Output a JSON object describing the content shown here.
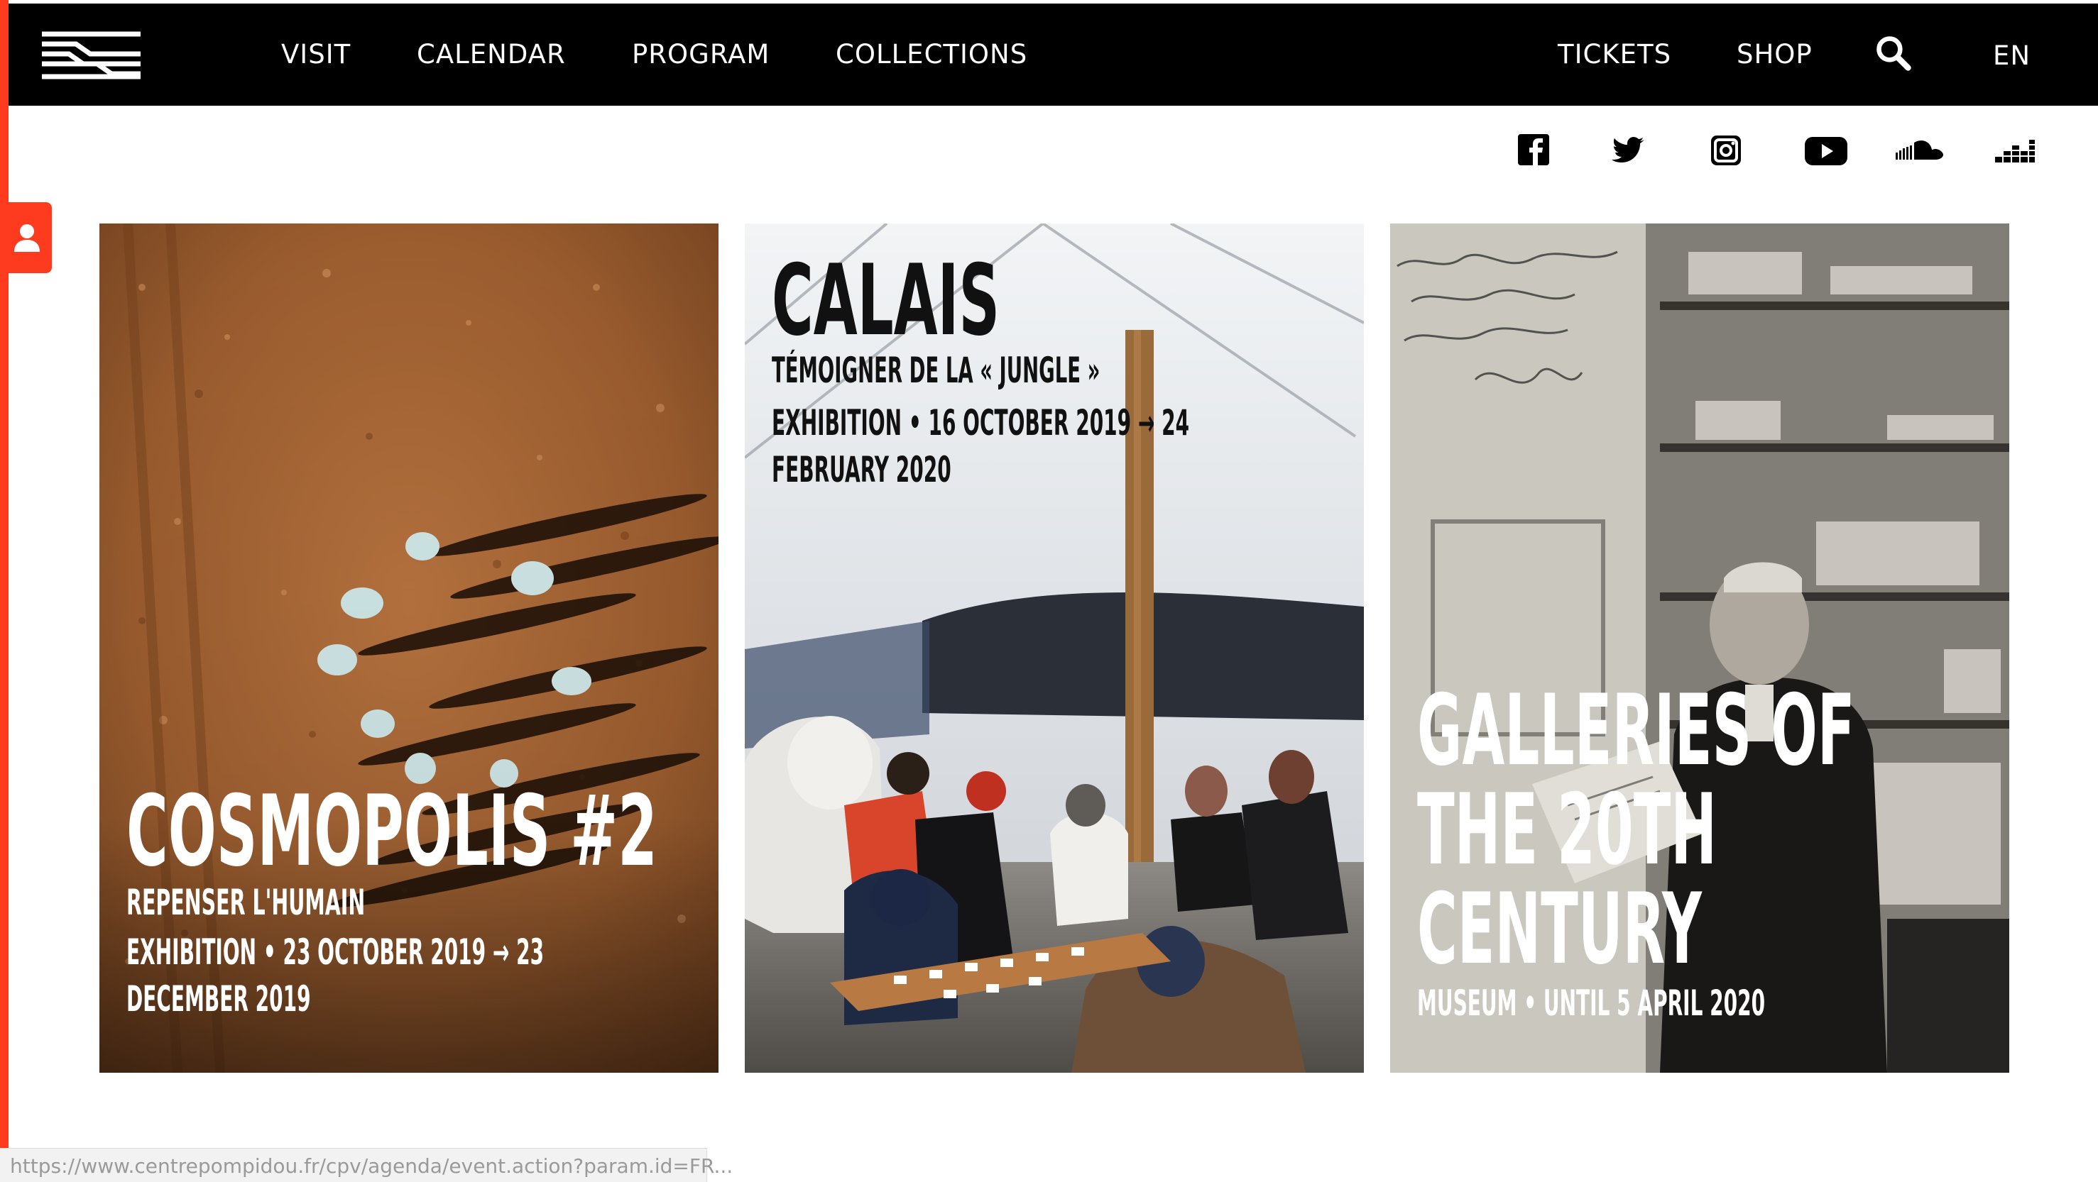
{
  "nav": {
    "logo_icon": "centre-pompidou-logo",
    "links": [
      "VISIT",
      "CALENDAR",
      "PROGRAM",
      "COLLECTIONS"
    ],
    "right_links": [
      "TICKETS",
      "SHOP"
    ],
    "language": "EN",
    "search_icon": "search-icon"
  },
  "social_icons": [
    "facebook-icon",
    "twitter-icon",
    "instagram-icon",
    "youtube-icon",
    "soundcloud-icon",
    "deezer-icon"
  ],
  "side_tab_icon": "user-icon",
  "cards": [
    {
      "title": "COSMOPOLIS #2",
      "subtitle": "REPENSER L'HUMAIN",
      "line1": "EXHIBITION • 23 OCTOBER 2019 → 23",
      "line2": "DECEMBER 2019"
    },
    {
      "title": "CALAIS",
      "subtitle": "TÉMOIGNER DE LA « JUNGLE »",
      "line1": "EXHIBITION • 16 OCTOBER 2019 → 24",
      "line2": "FEBRUARY 2020"
    },
    {
      "title_line1": "GALLERIES OF",
      "title_line2": "THE 20TH",
      "title_line3": "CENTURY",
      "subtitle": "MUSEUM • UNTIL 5 APRIL 2020"
    }
  ],
  "status_bar": {
    "url": "https://www.centrepompidou.fr/cpv/agenda/event.action?param.id=FR..."
  },
  "colors": {
    "accent": "#ff3b1f",
    "navbar": "#000000",
    "text_on_image": "#ffffff",
    "calais_text": "#111111"
  }
}
